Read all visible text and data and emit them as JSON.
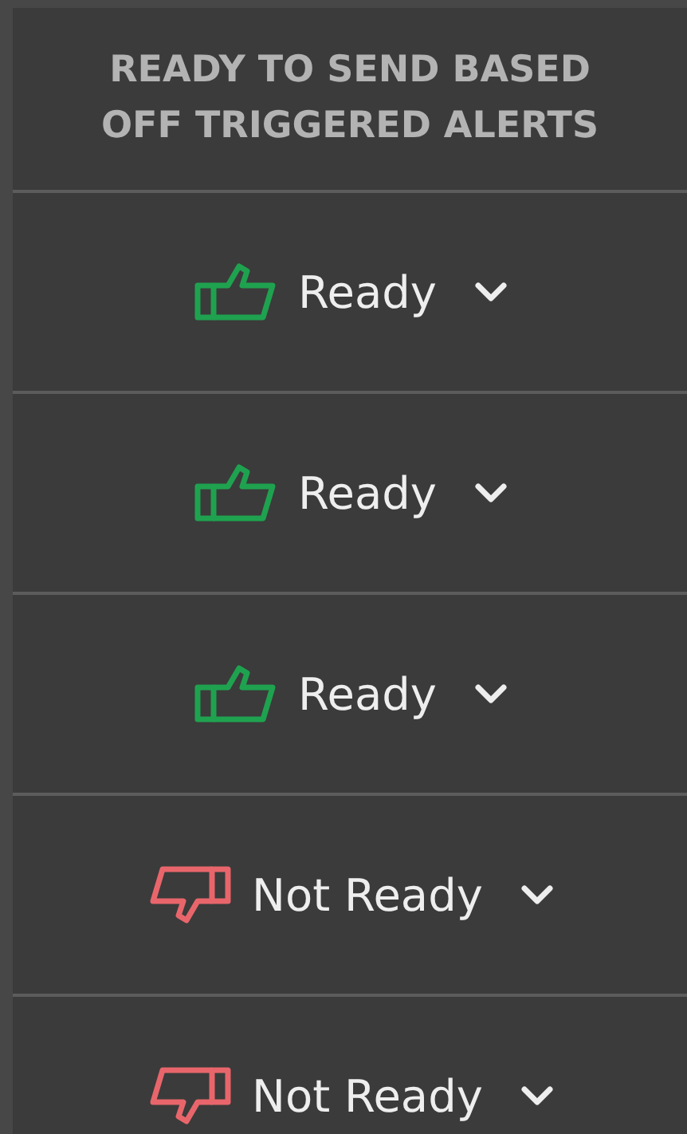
{
  "header": {
    "title": "READY TO SEND BASED OFF TRIGGERED ALERTS"
  },
  "rows": [
    {
      "kind": "ready",
      "label": "Ready"
    },
    {
      "kind": "ready",
      "label": "Ready"
    },
    {
      "kind": "ready",
      "label": "Ready"
    },
    {
      "kind": "not_ready",
      "label": "Not Ready"
    },
    {
      "kind": "not_ready",
      "label": "Not Ready"
    }
  ]
}
